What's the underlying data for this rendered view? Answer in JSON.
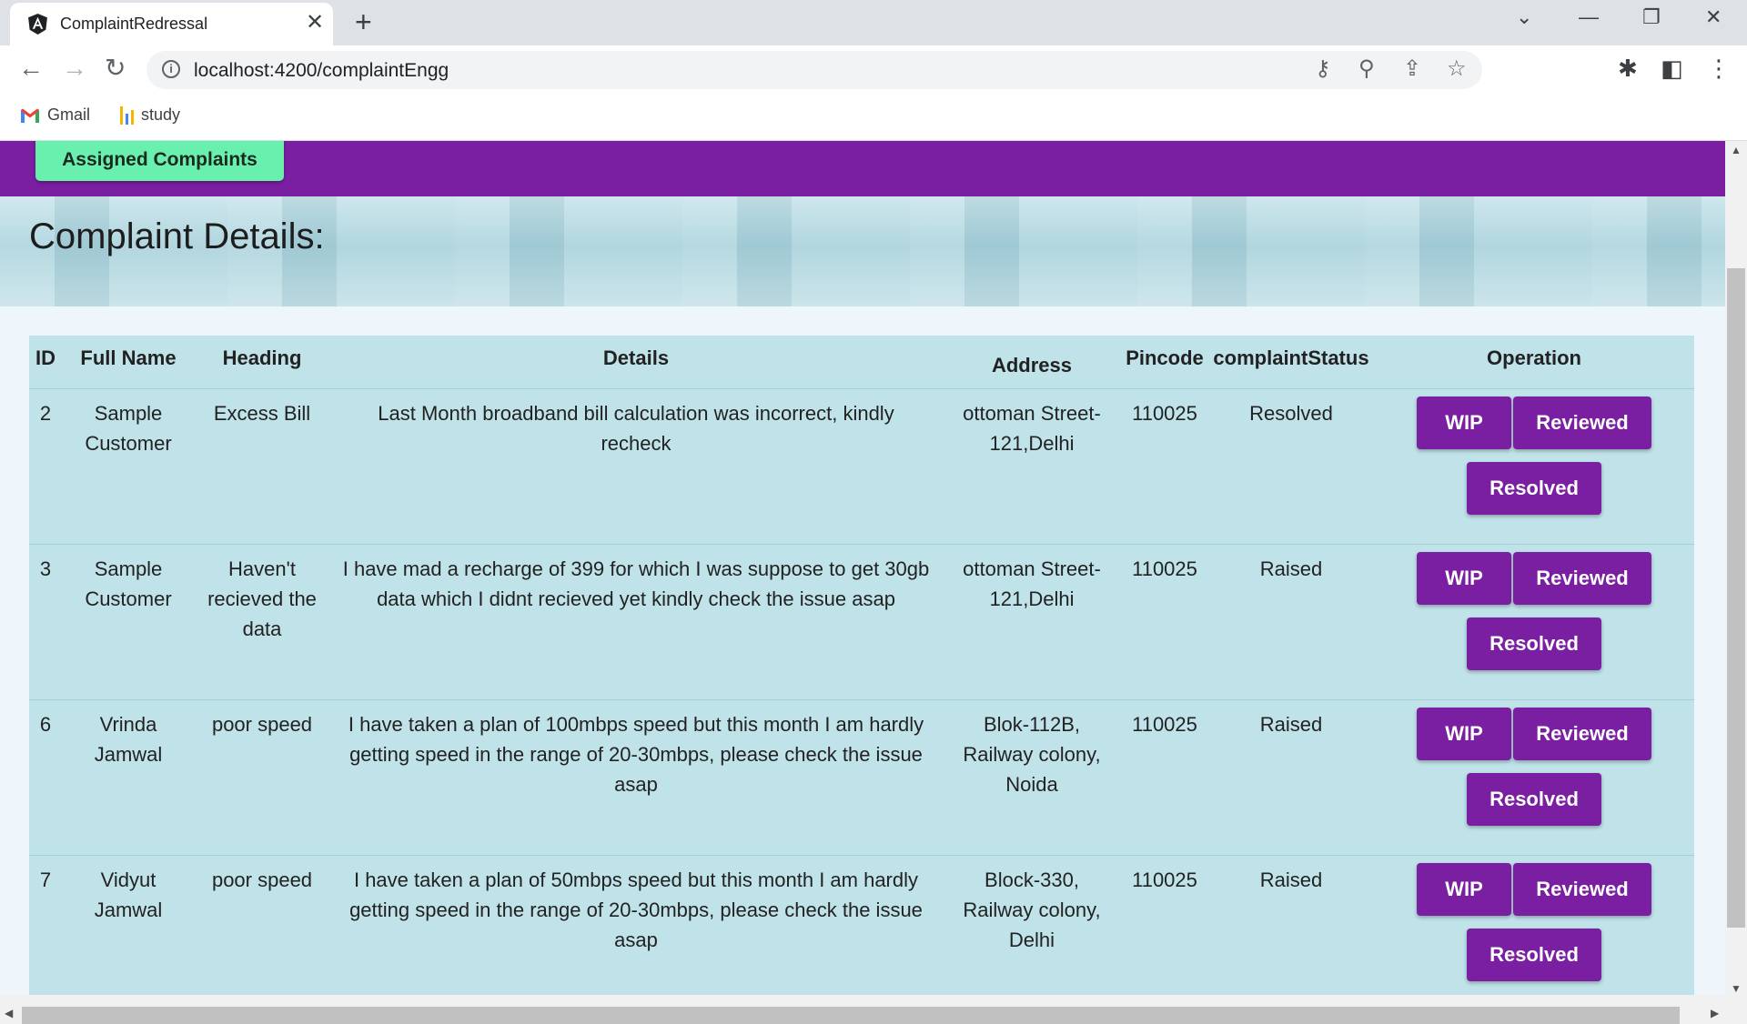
{
  "browser": {
    "tab_title": "ComplaintRedressal",
    "tab_close_glyph": "✕",
    "new_tab_glyph": "+",
    "url": "localhost:4200/complaintEngg",
    "bookmarks": [
      {
        "label": "Gmail",
        "icon": "gmail-icon"
      },
      {
        "label": "study",
        "icon": "study-chart-icon"
      }
    ],
    "icons": {
      "back": "←",
      "forward": "→",
      "reload": "↻",
      "key": "⚷",
      "zoom": "⚲",
      "share": "⇪",
      "star": "☆",
      "extensions": "✱",
      "sidepanel": "◧",
      "menu": "⋮",
      "tab_search": "⌄",
      "minimize": "—",
      "restore": "❐",
      "close": "✕"
    }
  },
  "navbar": {
    "assigned_label": "Assigned Complaints"
  },
  "hero": {
    "title": "Complaint Details:"
  },
  "table": {
    "headers": {
      "id": "ID",
      "full_name": "Full Name",
      "heading": "Heading",
      "details": "Details",
      "address": "Address",
      "pincode": "Pincode",
      "status": "complaintStatus",
      "operation": "Operation"
    },
    "rows": [
      {
        "id": "2",
        "full_name": "Sample Customer",
        "heading": "Excess Bill",
        "details": "Last Month broadband bill calculation was incorrect, kindly recheck",
        "address": "ottoman Street-121,Delhi",
        "pincode": "110025",
        "status": "Resolved"
      },
      {
        "id": "3",
        "full_name": "Sample Customer",
        "heading": "Haven't recieved the data",
        "details": "I have mad a recharge of 399 for which I was suppose to get 30gb data which I didnt recieved yet kindly check the issue asap",
        "address": "ottoman Street-121,Delhi",
        "pincode": "110025",
        "status": "Raised"
      },
      {
        "id": "6",
        "full_name": "Vrinda Jamwal",
        "heading": "poor speed",
        "details": "I have taken a plan of 100mbps speed but this month I am hardly getting speed in the range of 20-30mbps, please check the issue asap",
        "address": "Blok-112B, Railway colony, Noida",
        "pincode": "110025",
        "status": "Raised"
      },
      {
        "id": "7",
        "full_name": "Vidyut Jamwal",
        "heading": "poor speed",
        "details": "I have taken a plan of 50mbps speed but this month I am hardly getting speed in the range of 20-30mbps, please check the issue asap",
        "address": "Block-330, Railway colony, Delhi",
        "pincode": "110025",
        "status": "Raised"
      }
    ],
    "operations": {
      "wip": "WIP",
      "reviewed": "Reviewed",
      "resolved": "Resolved"
    }
  },
  "colors": {
    "navbar": "#7b1fa2",
    "assigned_button": "#69f0ae",
    "op_button": "#7b1fa2",
    "table_bg": "#c0e3ea",
    "page_bg": "#eff6fb"
  }
}
